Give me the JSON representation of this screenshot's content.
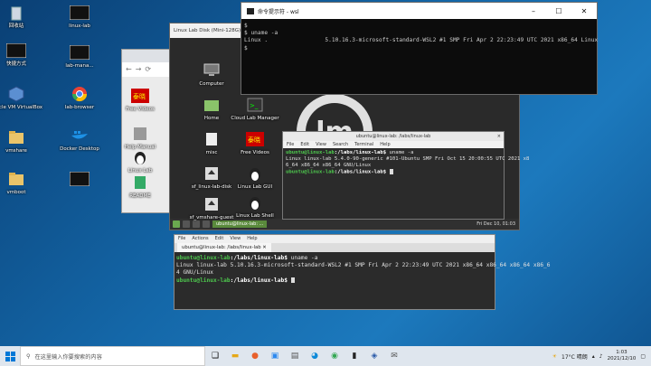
{
  "desktop": {
    "left_icons": [
      {
        "label": "回收站",
        "icon": "recycle-bin-icon"
      },
      {
        "label": "快捷方式",
        "icon": "shortcut-icon"
      },
      {
        "label": "Oracle VM VirtualBox",
        "icon": "virtualbox-icon"
      },
      {
        "label": "vmshare",
        "icon": "folder-icon"
      },
      {
        "label": "vmboot",
        "icon": "folder-icon"
      }
    ],
    "right_icons": [
      {
        "label": "linux-lab",
        "icon": "shortcut-icon"
      },
      {
        "label": "lab-mana...",
        "icon": "shortcut-icon"
      },
      {
        "label": "lab-browser",
        "icon": "chrome-icon"
      },
      {
        "label": "Docker Desktop",
        "icon": "docker-icon"
      },
      {
        "label": "",
        "icon": "shortcut-icon"
      }
    ]
  },
  "wsl_window": {
    "title": "命令提示符 - wsl",
    "lines": [
      "$",
      "$ uname -a",
      "Linux .                 5.10.16.3-microsoft-standard-WSL2 #1 SMP Fri Apr 2 22:23:49 UTC 2021 x86_64 Linux",
      "$"
    ]
  },
  "mint_window": {
    "title": "Linux Lab Disk (Mini-128G)",
    "menu": [
      "管理",
      "控制",
      "视图",
      "热键",
      "设备"
    ],
    "icons_col1": [
      "Computer",
      "Home",
      "misc",
      "sf_linux-lab-disk",
      "sf_vmshare-guest"
    ],
    "icons_col2": [
      "Cloud Lab Manager",
      "Free Videos",
      "Linux Lab GUI",
      "Linux Lab Shell"
    ],
    "taskbar_item": "ubuntu@linux-lab: ...",
    "datetime": "Fri Dec 10, 01:03"
  },
  "browser_window": {
    "side_items": [
      "Free Videos",
      "Help Manual",
      "Linux Lab",
      "README"
    ]
  },
  "inner_terminal": {
    "title": "ubuntu@linux-lab: /labs/linux-lab",
    "menu": [
      "File",
      "Edit",
      "View",
      "Search",
      "Terminal",
      "Help"
    ],
    "prompt": "ubuntu@linux-lab",
    "path": ":/labs/linux-lab$",
    "cmd": " uname -a",
    "out1": "Linux linux-lab 5.4.0-90-generic #101-Ubuntu SMP Fri Oct 15 20:00:55 UTC 2021 x8",
    "out2": "6_64 x86_64 x86_64 GNU/Linux"
  },
  "outer_terminal": {
    "menu": [
      "File",
      "Actions",
      "Edit",
      "View",
      "Help"
    ],
    "tab": "ubuntu@linux-lab: /labs/linux-lab",
    "prompt": "ubuntu@linux-lab",
    "path": ":/labs/linux-lab$",
    "cmd": " uname -a",
    "out1": "Linux linux-lab 5.10.16.3-microsoft-standard-WSL2 #1 SMP Fri Apr 2 22:23:49 UTC 2021 x86_64 x86_64 x86_64 x86_6",
    "out2": "4 GNU/Linux"
  },
  "taskbar": {
    "search_placeholder": "在这里输入你要搜索的内容",
    "weather": "17°C 晴朗",
    "time": "1:03",
    "date": "2021/12/10"
  }
}
